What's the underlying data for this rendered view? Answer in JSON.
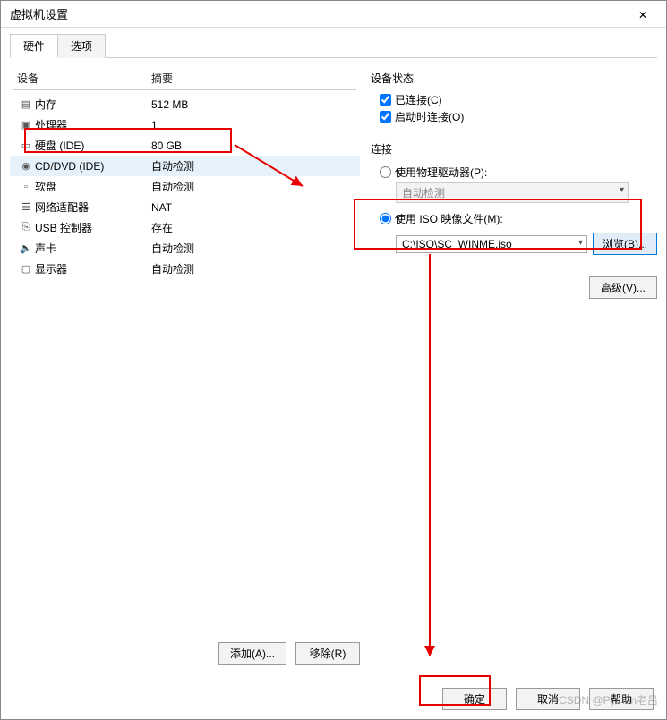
{
  "window": {
    "title": "虚拟机设置"
  },
  "tabs": {
    "hardware": "硬件",
    "options": "选项"
  },
  "headers": {
    "device": "设备",
    "summary": "摘要"
  },
  "devices": [
    {
      "icon": "memory-icon",
      "name": "内存",
      "summary": "512 MB"
    },
    {
      "icon": "cpu-icon",
      "name": "处理器",
      "summary": "1"
    },
    {
      "icon": "disk-icon",
      "name": "硬盘 (IDE)",
      "summary": "80 GB"
    },
    {
      "icon": "cd-icon",
      "name": "CD/DVD (IDE)",
      "summary": "自动检测"
    },
    {
      "icon": "floppy-icon",
      "name": "软盘",
      "summary": "自动检测"
    },
    {
      "icon": "nic-icon",
      "name": "网络适配器",
      "summary": "NAT"
    },
    {
      "icon": "usb-icon",
      "name": "USB 控制器",
      "summary": "存在"
    },
    {
      "icon": "sound-icon",
      "name": "声卡",
      "summary": "自动检测"
    },
    {
      "icon": "display-icon",
      "name": "显示器",
      "summary": "自动检测"
    }
  ],
  "left_buttons": {
    "add": "添加(A)...",
    "remove": "移除(R)"
  },
  "right": {
    "status_title": "设备状态",
    "connected": "已连接(C)",
    "connect_at_power_on": "启动时连接(O)",
    "connection_title": "连接",
    "use_physical_drive": "使用物理驱动器(P):",
    "physical_value": "自动检测",
    "use_iso": "使用 ISO 映像文件(M):",
    "iso_value": "C:\\ISO\\SC_WINME.iso",
    "browse": "浏览(B)...",
    "advanced": "高级(V)..."
  },
  "footer": {
    "ok": "确定",
    "cancel": "取消",
    "help": "帮助"
  },
  "watermark": "CSDN @Python老吕"
}
